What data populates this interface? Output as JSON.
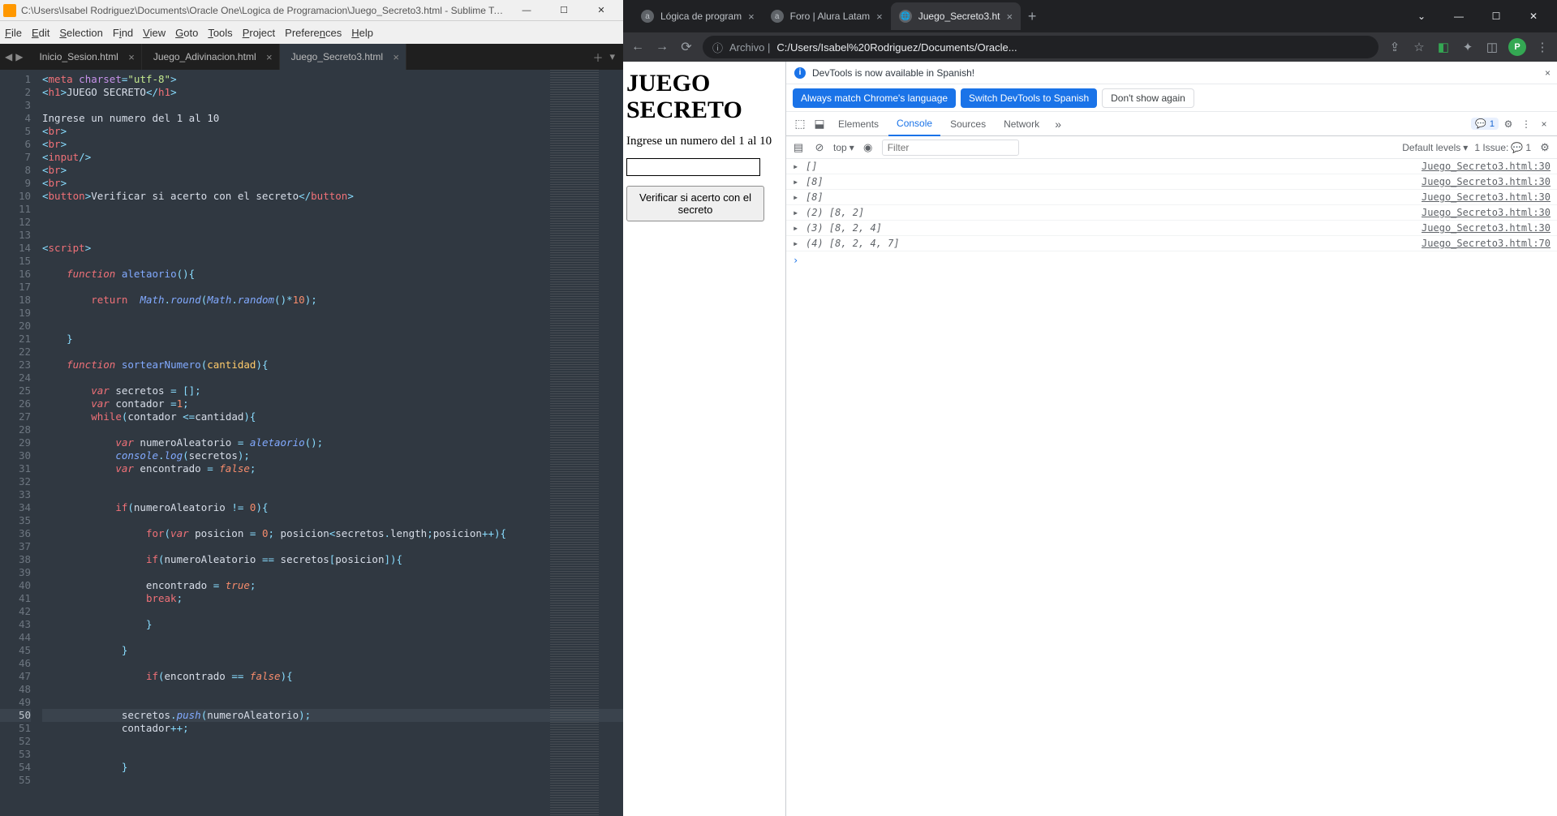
{
  "sublime": {
    "title": "C:\\Users\\Isabel Rodriguez\\Documents\\Oracle One\\Logica de Programacion\\Juego_Secreto3.html - Sublime Tex...",
    "menu": [
      "File",
      "Edit",
      "Selection",
      "Find",
      "View",
      "Goto",
      "Tools",
      "Project",
      "Preferences",
      "Help"
    ],
    "tabs": [
      {
        "label": "Inicio_Sesion.html",
        "active": false,
        "close": "×"
      },
      {
        "label": "Juego_Adivinacion.html",
        "active": false,
        "close": "×"
      },
      {
        "label": "Juego_Secreto3.html",
        "active": true,
        "close": "×"
      }
    ],
    "lines_start": 1,
    "lines_end": 55,
    "highlight_line": 50
  },
  "chrome": {
    "tabs": [
      {
        "fav": "a",
        "label": "Lógica de program"
      },
      {
        "fav": "a",
        "label": "Foro | Alura Latam"
      },
      {
        "fav": "🌐",
        "label": "Juego_Secreto3.ht",
        "active": true
      }
    ],
    "addr_prefix": "Archivo |",
    "addr_url": "C:/Users/Isabel%20Rodriguez/Documents/Oracle...",
    "avatar": "P"
  },
  "page": {
    "h1": "JUEGO SECRETO",
    "prompt": "Ingrese un numero del 1 al 10",
    "button": "Verificar si acerto con el secreto"
  },
  "devtools": {
    "info": "DevTools is now available in Spanish!",
    "btn_match": "Always match Chrome's language",
    "btn_switch": "Switch DevTools to Spanish",
    "btn_dont": "Don't show again",
    "tabs": [
      "Elements",
      "Console",
      "Sources",
      "Network"
    ],
    "active_tab": "Console",
    "badge_count": "1",
    "filter_top": "top",
    "filter_placeholder": "Filter",
    "levels": "Default levels",
    "issue_label": "1 Issue:",
    "issue_count": "1",
    "console": [
      {
        "msg": "[]",
        "src": "Juego_Secreto3.html:30"
      },
      {
        "msg": "[8]",
        "src": "Juego_Secreto3.html:30"
      },
      {
        "msg": "[8]",
        "src": "Juego_Secreto3.html:30"
      },
      {
        "msg_prefix": "(2) ",
        "msg": "[8, 2]",
        "src": "Juego_Secreto3.html:30"
      },
      {
        "msg_prefix": "(3) ",
        "msg": "[8, 2, 4]",
        "src": "Juego_Secreto3.html:30"
      },
      {
        "msg_prefix": "(4) ",
        "msg": "[8, 2, 4, 7]",
        "src": "Juego_Secreto3.html:70"
      }
    ]
  }
}
